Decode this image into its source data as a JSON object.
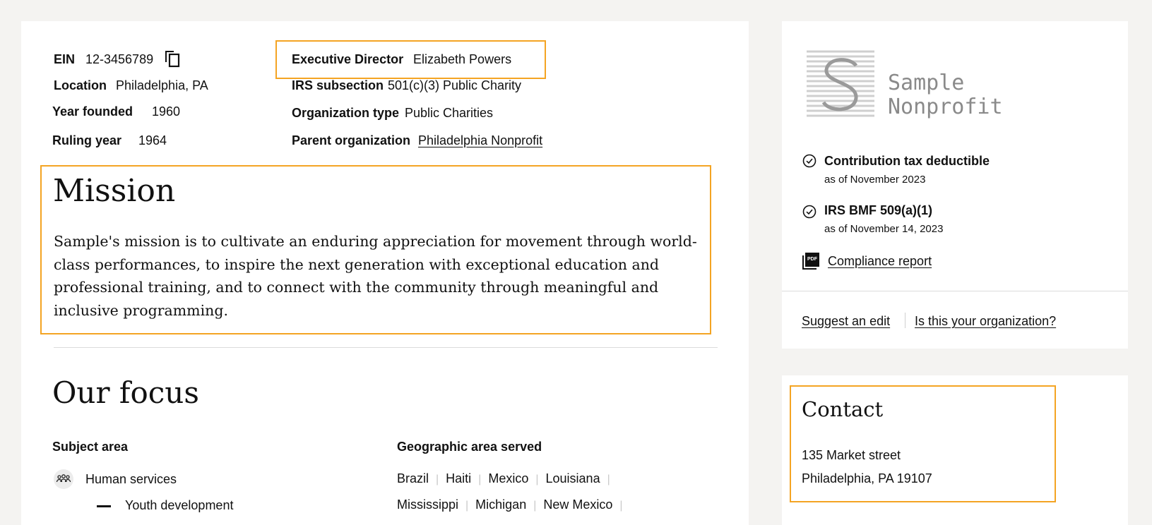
{
  "summary": {
    "ein_label": "EIN",
    "ein_value": "12-3456789",
    "location_label": "Location",
    "location_value": "Philadelphia, PA",
    "year_founded_label": "Year founded",
    "year_founded_value": "1960",
    "ruling_year_label": "Ruling year",
    "ruling_year_value": "1964",
    "exec_director_label": "Executive Director",
    "exec_director_value": "Elizabeth Powers",
    "irs_subsection_label": "IRS subsection",
    "irs_subsection_value": "501(c)(3) Public Charity",
    "org_type_label": "Organization type",
    "org_type_value": "Public Charities",
    "parent_org_label": "Parent organization",
    "parent_org_value": "Philadelphia Nonprofit"
  },
  "mission": {
    "title": "Mission",
    "text": "Sample's mission is to cultivate an enduring appreciation for movement through world-class performances, to inspire the next generation with exceptional education and professional training, and to connect with the community through meaningful and inclusive programming."
  },
  "focus": {
    "title": "Our focus",
    "subject_label": "Subject area",
    "subject_primary": "Human services",
    "subject_secondary": "Youth development",
    "geo_label": "Geographic area served",
    "geo_row1": [
      "Brazil",
      "Haiti",
      "Mexico",
      "Louisiana"
    ],
    "geo_row2": [
      "Mississippi",
      "Michigan",
      "New Mexico"
    ]
  },
  "sidebar": {
    "logo_line1": "Sample",
    "logo_line2": "Nonprofit",
    "status1_title": "Contribution tax deductible",
    "status1_sub": "as of November 2023",
    "status2_title": "IRS BMF 509(a)(1)",
    "status2_sub": "as of November 14, 2023",
    "pdf_badge": "PDF",
    "compliance_link": "Compliance report",
    "suggest_edit": "Suggest an edit",
    "claim_org": "Is this your organization?"
  },
  "contact": {
    "title": "Contact",
    "address1": "135 Market street",
    "address2": "Philadelphia, PA 19107"
  },
  "colors": {
    "highlight": "#f4a423",
    "background": "#f4f3f1"
  }
}
